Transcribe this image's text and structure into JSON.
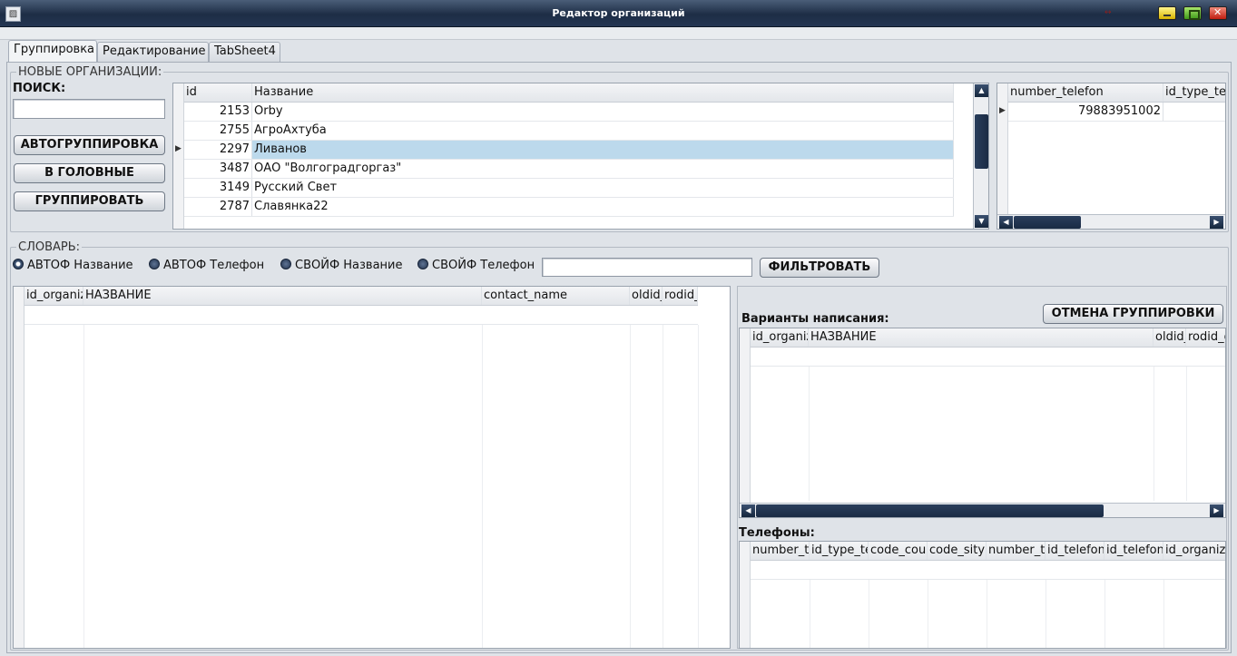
{
  "window": {
    "title": "Редактор организаций",
    "icon": "app-icon"
  },
  "tabs": [
    {
      "label": "Группировка",
      "active": true
    },
    {
      "label": "Редактирование",
      "active": false
    },
    {
      "label": "TabSheet4",
      "active": false
    }
  ],
  "new_orgs": {
    "legend": "НОВЫЕ ОРГАНИЗАЦИИ:",
    "search_label": "ПОИСК:",
    "search_value": "",
    "btn_autogroup": "АВТОГРУППИРОВКА",
    "btn_to_head": "В ГОЛОВНЫЕ",
    "btn_group": "ГРУППИРОВАТЬ",
    "grid": {
      "columns": [
        "id",
        "Название"
      ],
      "rows": [
        {
          "id": "2153",
          "name": "Orby"
        },
        {
          "id": "2755",
          "name": "АгроАхтуба"
        },
        {
          "id": "2297",
          "name": "Ливанов"
        },
        {
          "id": "3487",
          "name": "ОАО \"Волгоградгоргаз\""
        },
        {
          "id": "3149",
          "name": "Русский Свет"
        },
        {
          "id": "2787",
          "name": "Славянка22"
        }
      ],
      "selected_row": 2
    },
    "phone_grid": {
      "columns": [
        "number_telefon",
        "id_type_tel"
      ],
      "rows": [
        {
          "number_telefon": "79883951002",
          "id_type_tel": ""
        }
      ]
    }
  },
  "dictionary": {
    "legend": "СЛОВАРЬ:",
    "radios": [
      {
        "label": "АВТОФ Название",
        "checked": true
      },
      {
        "label": "АВТОФ Телефон",
        "checked": false
      },
      {
        "label": "СВОЙФ Название",
        "checked": false
      },
      {
        "label": "СВОЙФ Телефон",
        "checked": false
      }
    ],
    "filter_value": "",
    "btn_filter": "ФИЛЬТРОВАТЬ",
    "main_grid": {
      "columns": [
        "id_organiz",
        "НАЗВАНИЕ",
        "contact_name",
        "oldid_",
        "rodid_"
      ]
    },
    "btn_cancel_group": "ОТМЕНА ГРУППИРОВКИ",
    "variants_label": "Варианты написания:",
    "variants_grid": {
      "columns": [
        "id_organiz",
        "НАЗВАНИЕ",
        "oldid_",
        "rodid_o"
      ]
    },
    "phones_label": "Телефоны:",
    "phones_grid": {
      "columns": [
        "number_te",
        "id_type_te",
        "code_cou",
        "code_sity",
        "number_te",
        "id_telefon_",
        "id_telefon_",
        "id_organiz"
      ]
    }
  },
  "colors": {
    "selection": "#bcd9ec",
    "titlebar": "#1d2d45",
    "scrollbar": "#2a3e5c"
  }
}
